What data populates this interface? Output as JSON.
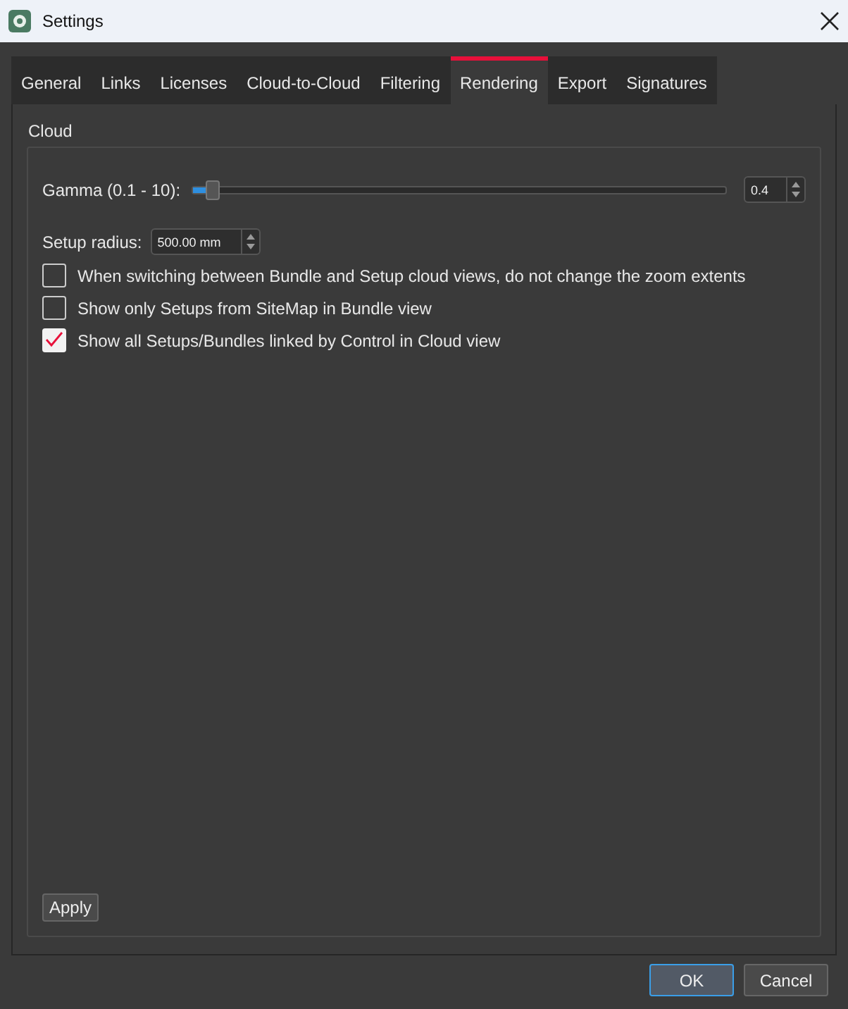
{
  "window": {
    "title": "Settings"
  },
  "tabs": [
    {
      "label": "General",
      "selected": false
    },
    {
      "label": "Links",
      "selected": false
    },
    {
      "label": "Licenses",
      "selected": false
    },
    {
      "label": "Cloud-to-Cloud",
      "selected": false
    },
    {
      "label": "Filtering",
      "selected": false
    },
    {
      "label": "Rendering",
      "selected": true
    },
    {
      "label": "Export",
      "selected": false
    },
    {
      "label": "Signatures",
      "selected": false
    }
  ],
  "group": {
    "title": "Cloud",
    "gamma": {
      "label": "Gamma (0.1 - 10):",
      "level": 0.04,
      "value": "0.4"
    },
    "setup_radius": {
      "label": "Setup radius:",
      "value": "500.00 mm"
    },
    "options": [
      {
        "label": "When switching between Bundle and Setup cloud views, do not change the zoom extents",
        "checked": false
      },
      {
        "label": "Show only Setups from SiteMap in Bundle view",
        "checked": false
      },
      {
        "label": "Show all Setups/Bundles linked by Control in Cloud view",
        "checked": true
      }
    ],
    "apply": "Apply"
  },
  "buttons": [
    {
      "label": "OK",
      "kind": "default"
    },
    {
      "label": "Cancel",
      "kind": "normal"
    }
  ]
}
